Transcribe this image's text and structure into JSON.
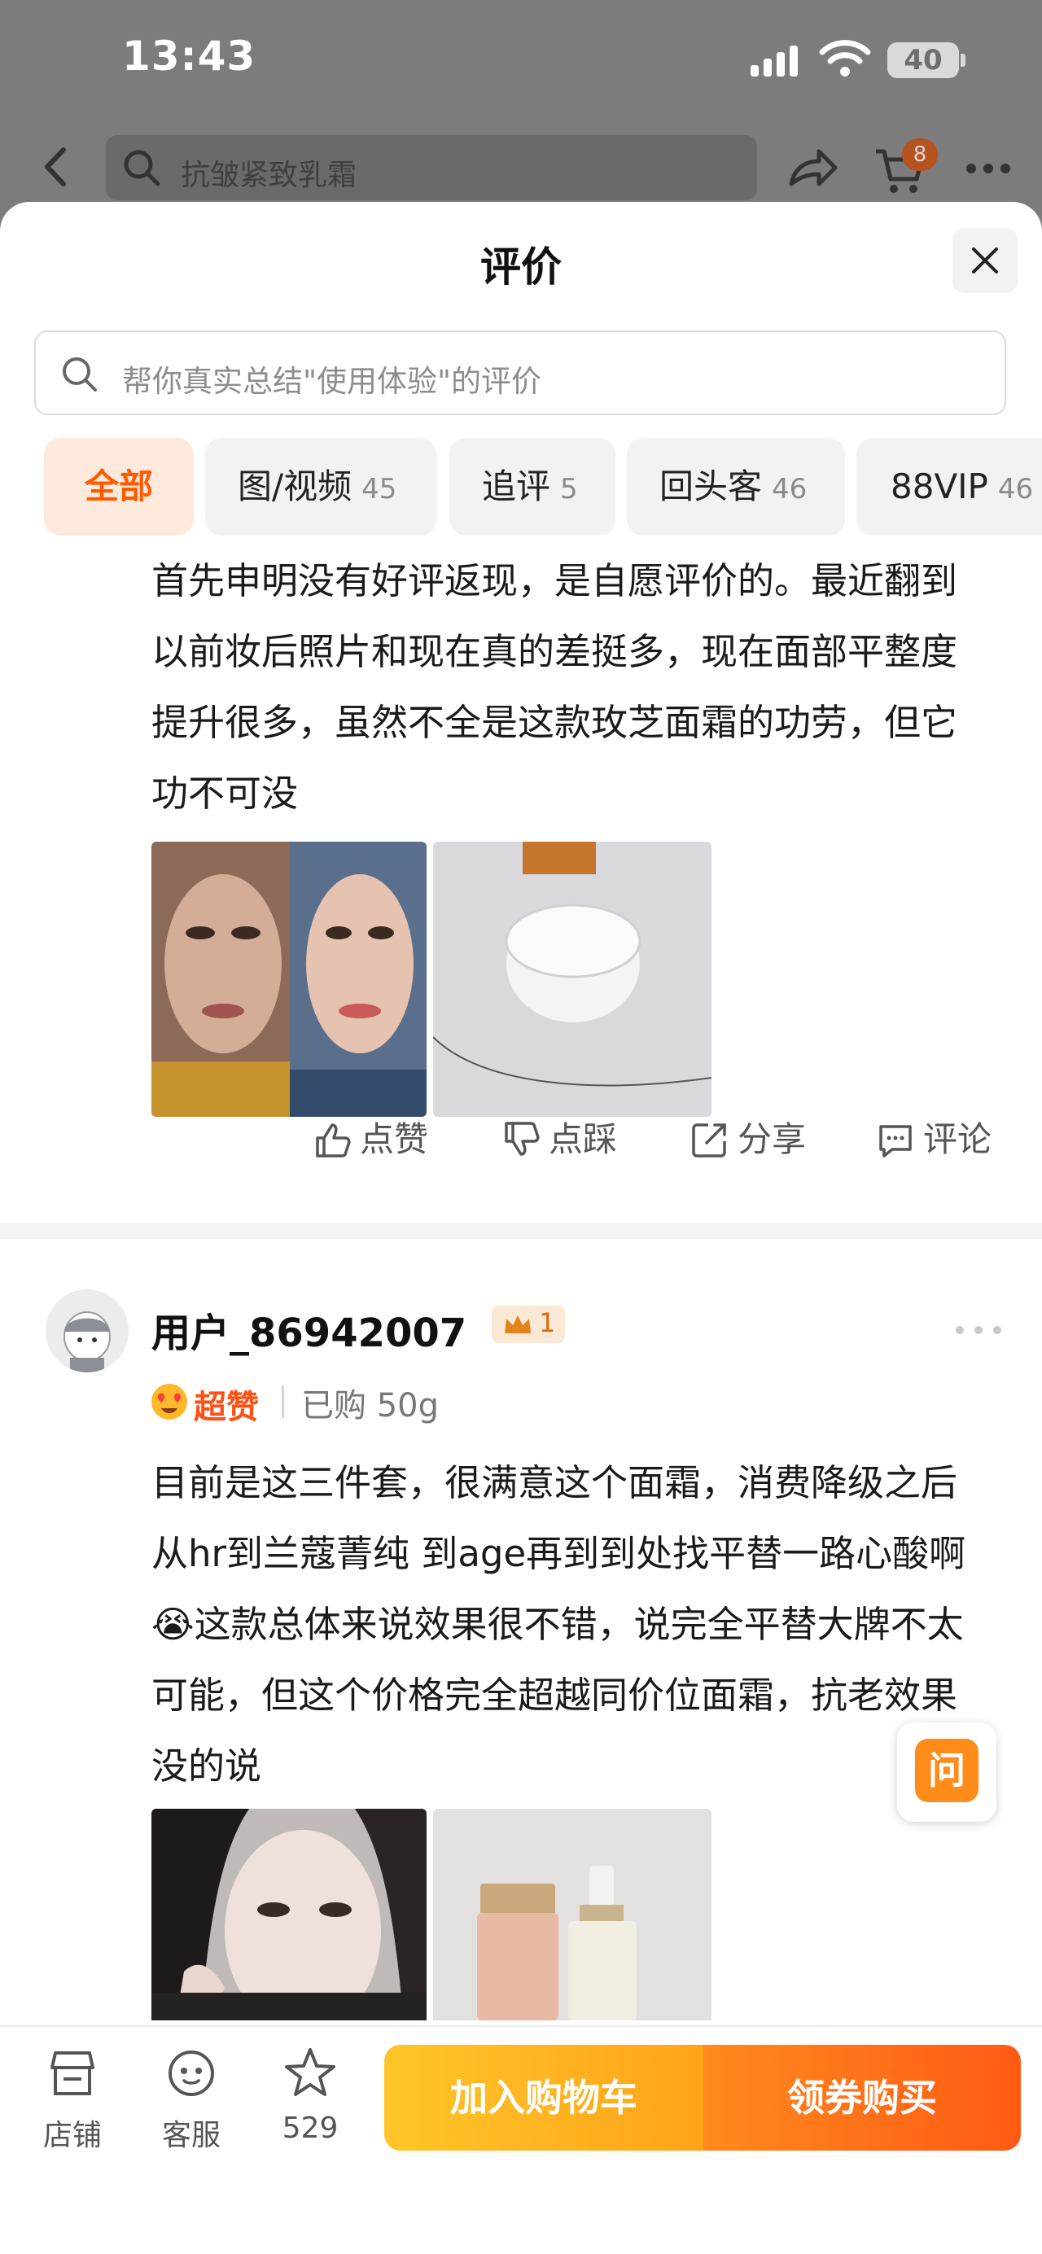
{
  "status_bar": {
    "time": "13:43",
    "battery": "40"
  },
  "top_nav": {
    "search_placeholder": "抗皱紧致乳霜",
    "cart_count": "8"
  },
  "sheet": {
    "title": "评价",
    "search_placeholder": "帮你真实总结\"使用体验\"的评价",
    "filters": [
      {
        "label": "全部",
        "count": ""
      },
      {
        "label": "图/视频",
        "count": "45"
      },
      {
        "label": "追评",
        "count": "5"
      },
      {
        "label": "回头客",
        "count": "46"
      },
      {
        "label": "88VIP",
        "count": "46"
      }
    ]
  },
  "reviews": [
    {
      "text": "首先申明没有好评返现，是自愿评价的。最近翻到以前妆后照片和现在真的差挺多，现在面部平整度提升很多，虽然不全是这款玫芝面霜的功劳，但它功不可没",
      "actions": {
        "like": "点赞",
        "dislike": "点踩",
        "share": "分享",
        "comment": "评论"
      }
    },
    {
      "username": "用户_86942007",
      "level": "1",
      "rating_label": "超赞",
      "purchase_spec": "已购 50g",
      "text": "目前是这三件套，很满意这个面霜，消费降级之后从hr到兰蔻菁纯 到age再到到处找平替一路心酸啊😭这款总体来说效果很不错，说完全平替大牌不太可能，但这个价格完全超越同价位面霜，抗老效果没的说"
    }
  ],
  "ask_button": "问",
  "bottom_bar": {
    "store": "店铺",
    "service": "客服",
    "favorites": "529",
    "add_to_cart": "加入购物车",
    "coupon_buy": "领券购买"
  },
  "colors": {
    "accent": "#ff5a00",
    "cart_gradient": [
      "#ffc52a",
      "#ffa318"
    ],
    "buy_gradient": [
      "#ff8a1e",
      "#ff5a14"
    ]
  }
}
